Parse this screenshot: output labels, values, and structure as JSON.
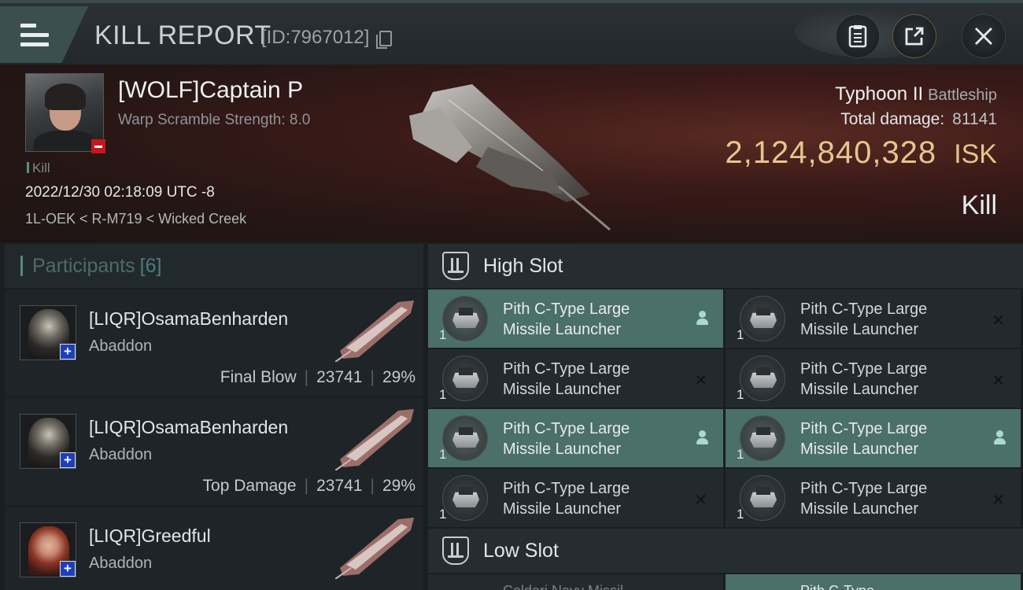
{
  "header": {
    "title": "KILL REPORT",
    "report_id": "[ID:7967012]",
    "icons": [
      "menu-icon",
      "clipboard-icon",
      "share-icon",
      "close-icon"
    ]
  },
  "victim": {
    "name": "[WOLF]Captain P",
    "scramble": "Warp Scramble Strength: 8.0",
    "tag": "Kill",
    "timestamp": "2022/12/30 02:18:09 UTC -8",
    "location": "1L-OEK < R-M719 < Wicked Creek",
    "ship": "Typhoon II",
    "ship_class": "Battleship",
    "total_damage_label": "Total damage:",
    "total_damage": "81141",
    "isk_value": "2,124,840,328",
    "isk_unit": "ISK",
    "result": "Kill"
  },
  "participants": {
    "label": "Participants",
    "count": "[6]",
    "rows": [
      {
        "name": "[LIQR]OsamaBenharden",
        "ship": "Abaddon",
        "role": "Final Blow",
        "damage": "23741",
        "percent": "29%"
      },
      {
        "name": "[LIQR]OsamaBenharden",
        "ship": "Abaddon",
        "role": "Top Damage",
        "damage": "23741",
        "percent": "29%"
      },
      {
        "name": "[LIQR]Greedful",
        "ship": "Abaddon",
        "role": "",
        "damage": "",
        "percent": ""
      }
    ]
  },
  "slots": {
    "high_label": "High Slot",
    "low_label": "Low Slot",
    "high_modules": [
      {
        "line1": "Pith C-Type Large",
        "line2": "Missile Launcher",
        "qty": "1",
        "fitted": true
      },
      {
        "line1": "Pith C-Type Large",
        "line2": "Missile Launcher",
        "qty": "1",
        "fitted": false
      },
      {
        "line1": "Pith C-Type Large",
        "line2": "Missile Launcher",
        "qty": "1",
        "fitted": false
      },
      {
        "line1": "Pith C-Type Large",
        "line2": "Missile Launcher",
        "qty": "1",
        "fitted": false
      },
      {
        "line1": "Pith C-Type Large",
        "line2": "Missile Launcher",
        "qty": "1",
        "fitted": true
      },
      {
        "line1": "Pith C-Type Large",
        "line2": "Missile Launcher",
        "qty": "1",
        "fitted": true
      },
      {
        "line1": "Pith C-Type Large",
        "line2": "Missile Launcher",
        "qty": "1",
        "fitted": false
      },
      {
        "line1": "Pith C-Type Large",
        "line2": "Missile Launcher",
        "qty": "1",
        "fitted": false
      }
    ],
    "low_partial": [
      "Caldari Navy Missil",
      "Pith C-Type"
    ]
  },
  "colors": {
    "accent_teal": "#4b6f69",
    "isk_gold": "#e6c58d",
    "destroyed_red": "#c4171d"
  }
}
